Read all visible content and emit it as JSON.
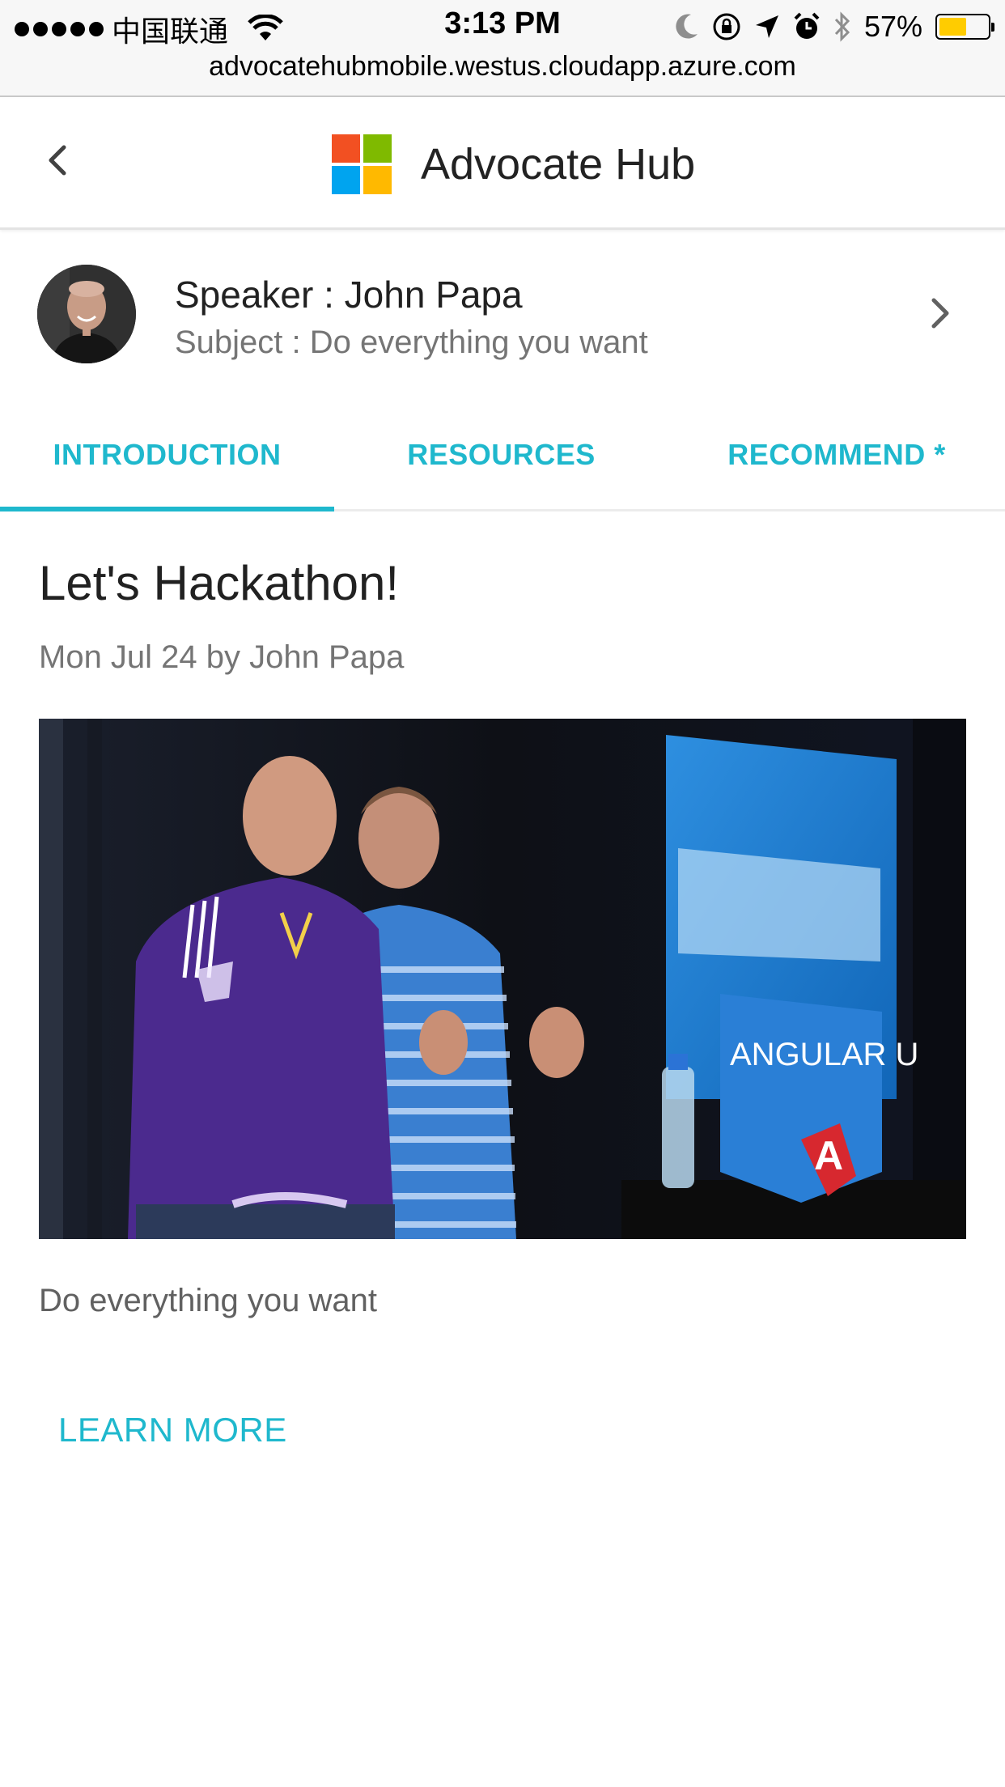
{
  "status_bar": {
    "carrier": "中国联通",
    "time": "3:13 PM",
    "battery": "57%",
    "battery_level": 0.57
  },
  "browser": {
    "url": "advocatehubmobile.westus.cloudapp.azure.com"
  },
  "header": {
    "title": "Advocate Hub",
    "logo_colors": [
      "#f25022",
      "#7fba00",
      "#00a4ef",
      "#ffb900"
    ]
  },
  "speaker": {
    "name_line": "Speaker : John Papa",
    "subject_line": "Subject : Do everything you want"
  },
  "tabs": [
    {
      "label": "INTRODUCTION",
      "active": true
    },
    {
      "label": "RESOURCES",
      "active": false
    },
    {
      "label": "RECOMMEND *",
      "active": false
    }
  ],
  "article": {
    "title": "Let's Hackathon!",
    "meta": "Mon Jul 24 by John Papa",
    "body": "Do everything you want",
    "learn_more": "LEARN MORE",
    "image": {
      "banner_text": "ANGULAR U",
      "logo_letter": "A"
    }
  },
  "colors": {
    "accent": "#1fb8cd",
    "secondary_text": "#757575"
  }
}
